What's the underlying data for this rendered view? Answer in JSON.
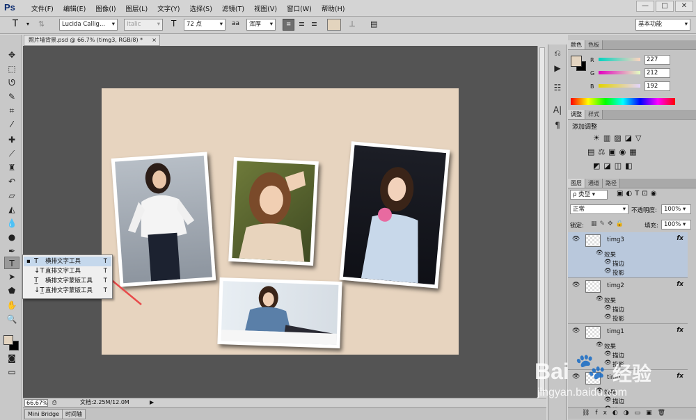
{
  "app": {
    "logo": "Ps"
  },
  "menu": [
    "文件(F)",
    "编辑(E)",
    "图像(I)",
    "图层(L)",
    "文字(Y)",
    "选择(S)",
    "滤镜(T)",
    "视图(V)",
    "窗口(W)",
    "帮助(H)"
  ],
  "window_buttons": [
    "—",
    "□",
    "✕"
  ],
  "options": {
    "tool_icon": "T",
    "font_family": "Lucida Callig...",
    "font_style": "Italic",
    "font_size_icon": "T",
    "font_size": "72 点",
    "aa_label": "aa",
    "antialias": "浑厚",
    "workspace": "基本功能",
    "swatch_color": "#e3d4be"
  },
  "document": {
    "tab_title": "照片墙背景.psd @ 66.7% (timg3, RGB/8) *",
    "tab_close": "×"
  },
  "status": {
    "zoom": "66.67%",
    "doc_info": "文档:2.25M/12.0M"
  },
  "bottom_tabs": [
    "Mini Bridge",
    "时间轴"
  ],
  "flyout": {
    "items": [
      {
        "icon": "T",
        "label": "横排文字工具",
        "key": "T",
        "selected": true
      },
      {
        "icon": "↓T",
        "label": "直排文字工具",
        "key": "T",
        "selected": false
      },
      {
        "icon": "T̲",
        "label": "横排文字蒙版工具",
        "key": "T",
        "selected": false
      },
      {
        "icon": "↓T̲",
        "label": "直排文字蒙版工具",
        "key": "T",
        "selected": false
      }
    ]
  },
  "tools": [
    "move-icon",
    "marquee-icon",
    "lasso-icon",
    "quick-select-icon",
    "crop-icon",
    "eyedropper-icon",
    "healing-icon",
    "brush-icon",
    "stamp-icon",
    "history-brush-icon",
    "eraser-icon",
    "bucket-icon",
    "blur-icon",
    "dodge-icon",
    "pen-icon",
    "type-icon",
    "path-select-icon",
    "shape-icon",
    "hand-icon",
    "zoom-icon"
  ],
  "color_panel": {
    "tabs": [
      "颜色",
      "色板"
    ],
    "R": "227",
    "G": "212",
    "B": "192",
    "r_label": "R",
    "g_label": "G",
    "b_label": "B",
    "fg": "#e3d4c0",
    "bg": "#000000"
  },
  "adjust_panel": {
    "tabs": [
      "调整",
      "样式"
    ],
    "title": "添加调整"
  },
  "layers_panel": {
    "tabs": [
      "图层",
      "通道",
      "路径"
    ],
    "kind": "ρ 类型",
    "blend": "正常",
    "opacity_label": "不透明度:",
    "opacity": "100%",
    "lock_label": "锁定:",
    "fill_label": "填充:",
    "fill": "100%",
    "layers": [
      {
        "name": "timg3",
        "effects": "效果",
        "fx1": "描边",
        "fx2": "投影",
        "selected": true
      },
      {
        "name": "timg2",
        "effects": "效果",
        "fx1": "描边",
        "fx2": "投影",
        "selected": false
      },
      {
        "name": "timg1",
        "effects": "效果",
        "fx1": "描边",
        "fx2": "投影",
        "selected": false
      },
      {
        "name": "timg",
        "effects": "效果",
        "fx1": "描边",
        "fx2": "投影",
        "selected": false
      }
    ]
  },
  "watermark": {
    "brand": "Bai",
    "paw": "🐾",
    "brand2": "经验",
    "url": "jingyan.baidu.com"
  },
  "colors": {
    "canvas_bg": "#e7d4bf",
    "workspace_bg": "#545454",
    "arrow": "#e84a4a"
  }
}
